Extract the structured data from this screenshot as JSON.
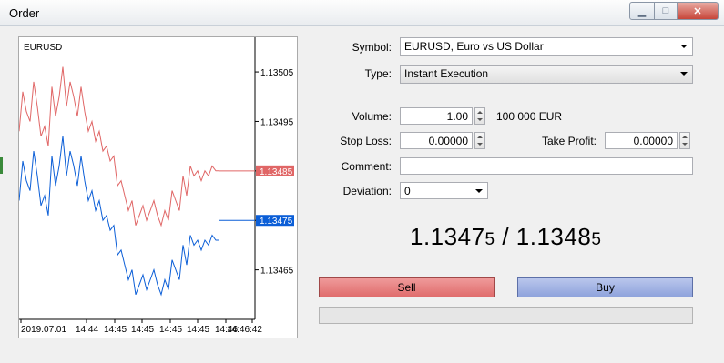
{
  "window": {
    "title": "Order",
    "min_glyph": "▁",
    "max_glyph": "□",
    "close_glyph": "✕"
  },
  "chart": {
    "symbol": "EURUSD",
    "price_labels": [
      "1.13505",
      "1.13495",
      "1.13485",
      "1.13475",
      "1.13465"
    ],
    "price_values": [
      1.13505,
      1.13495,
      1.13485,
      1.13475,
      1.13465
    ],
    "ask_tag": "1.13485",
    "bid_tag": "1.13475",
    "time_labels": [
      "2019.07.01",
      "14:44",
      "14:45",
      "14:45",
      "14:45",
      "14:45",
      "14:46",
      "14:46:42"
    ],
    "ask_color": "#e06666",
    "bid_color": "#0b5ed7",
    "ask_series": [
      1.13493,
      1.13501,
      1.13497,
      1.13495,
      1.13503,
      1.13498,
      1.13492,
      1.13494,
      1.1349,
      1.13502,
      1.13496,
      1.135,
      1.13506,
      1.13498,
      1.13503,
      1.135,
      1.13496,
      1.13502,
      1.13497,
      1.13493,
      1.13495,
      1.13491,
      1.13493,
      1.13489,
      1.1349,
      1.13487,
      1.13488,
      1.13482,
      1.13483,
      1.1348,
      1.13477,
      1.13479,
      1.13474,
      1.13476,
      1.13478,
      1.13475,
      1.13477,
      1.13479,
      1.13476,
      1.13474,
      1.13477,
      1.13475,
      1.13481,
      1.13479,
      1.13477,
      1.13484,
      1.1348,
      1.13486,
      1.13484,
      1.13485,
      1.13483,
      1.13485,
      1.13484,
      1.13486,
      1.13485,
      1.13485
    ],
    "bid_series": [
      1.13479,
      1.13487,
      1.13483,
      1.13481,
      1.13489,
      1.13484,
      1.13478,
      1.1348,
      1.13476,
      1.13488,
      1.13482,
      1.13486,
      1.13492,
      1.13484,
      1.13489,
      1.13486,
      1.13482,
      1.13488,
      1.13483,
      1.13479,
      1.13481,
      1.13477,
      1.13479,
      1.13475,
      1.13476,
      1.13473,
      1.13474,
      1.13468,
      1.13469,
      1.13466,
      1.13463,
      1.13465,
      1.1346,
      1.13462,
      1.13464,
      1.13461,
      1.13463,
      1.13465,
      1.13462,
      1.1346,
      1.13463,
      1.13461,
      1.13467,
      1.13465,
      1.13463,
      1.1347,
      1.13466,
      1.13472,
      1.1347,
      1.13471,
      1.13469,
      1.13471,
      1.1347,
      1.13472,
      1.13471,
      1.13471
    ]
  },
  "form": {
    "symbol_label": "Symbol:",
    "symbol_value": "EURUSD, Euro vs US Dollar",
    "type_label": "Type:",
    "type_value": "Instant Execution",
    "volume_label": "Volume:",
    "volume_value": "1.00",
    "volume_unit": "100 000 EUR",
    "sl_label": "Stop Loss:",
    "sl_value": "0.00000",
    "tp_label": "Take Profit:",
    "tp_value": "0.00000",
    "comment_label": "Comment:",
    "comment_value": "",
    "deviation_label": "Deviation:",
    "deviation_value": "0"
  },
  "quote": {
    "bid_main": "1.1347",
    "bid_small": "5",
    "separator": " / ",
    "ask_main": "1.1348",
    "ask_small": "5"
  },
  "actions": {
    "sell_label": "Sell",
    "buy_label": "Buy"
  }
}
